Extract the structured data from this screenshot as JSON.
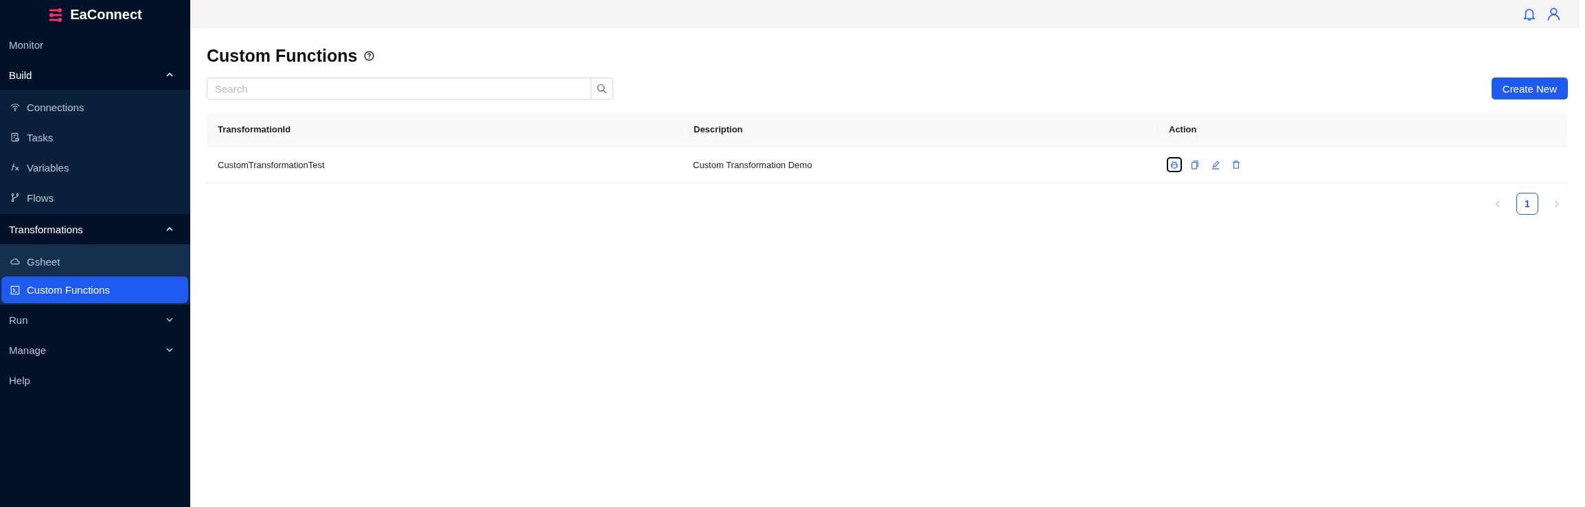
{
  "brand": {
    "name": "EaConnect"
  },
  "sidebar": {
    "items": [
      {
        "label": "Monitor",
        "kind": "link"
      },
      {
        "label": "Build",
        "kind": "group",
        "expanded": true,
        "children": [
          {
            "label": "Connections",
            "selected": false
          },
          {
            "label": "Tasks",
            "selected": false
          },
          {
            "label": "Variables",
            "selected": false
          },
          {
            "label": "Flows",
            "selected": false
          }
        ]
      },
      {
        "label": "Transformations",
        "kind": "group",
        "expanded": true,
        "children": [
          {
            "label": "Gsheet",
            "selected": false
          },
          {
            "label": "Custom Functions",
            "selected": true
          }
        ]
      },
      {
        "label": "Run",
        "kind": "group",
        "expanded": false
      },
      {
        "label": "Manage",
        "kind": "group",
        "expanded": false
      },
      {
        "label": "Help",
        "kind": "link"
      }
    ]
  },
  "page": {
    "title": "Custom Functions",
    "search": {
      "placeholder": "Search"
    },
    "create_button": "Create New"
  },
  "table": {
    "columns": [
      "TransformationId",
      "Description",
      "Action"
    ],
    "rows": [
      {
        "cells": [
          "CustomTransformationTest",
          "Custom Transformation Demo"
        ],
        "actions": [
          {
            "focused": true
          },
          {
            "focused": false
          },
          {
            "focused": false
          },
          {
            "focused": false
          }
        ]
      }
    ]
  },
  "pagination": {
    "pages": [
      {
        "label": "1",
        "selected": true
      }
    ]
  }
}
